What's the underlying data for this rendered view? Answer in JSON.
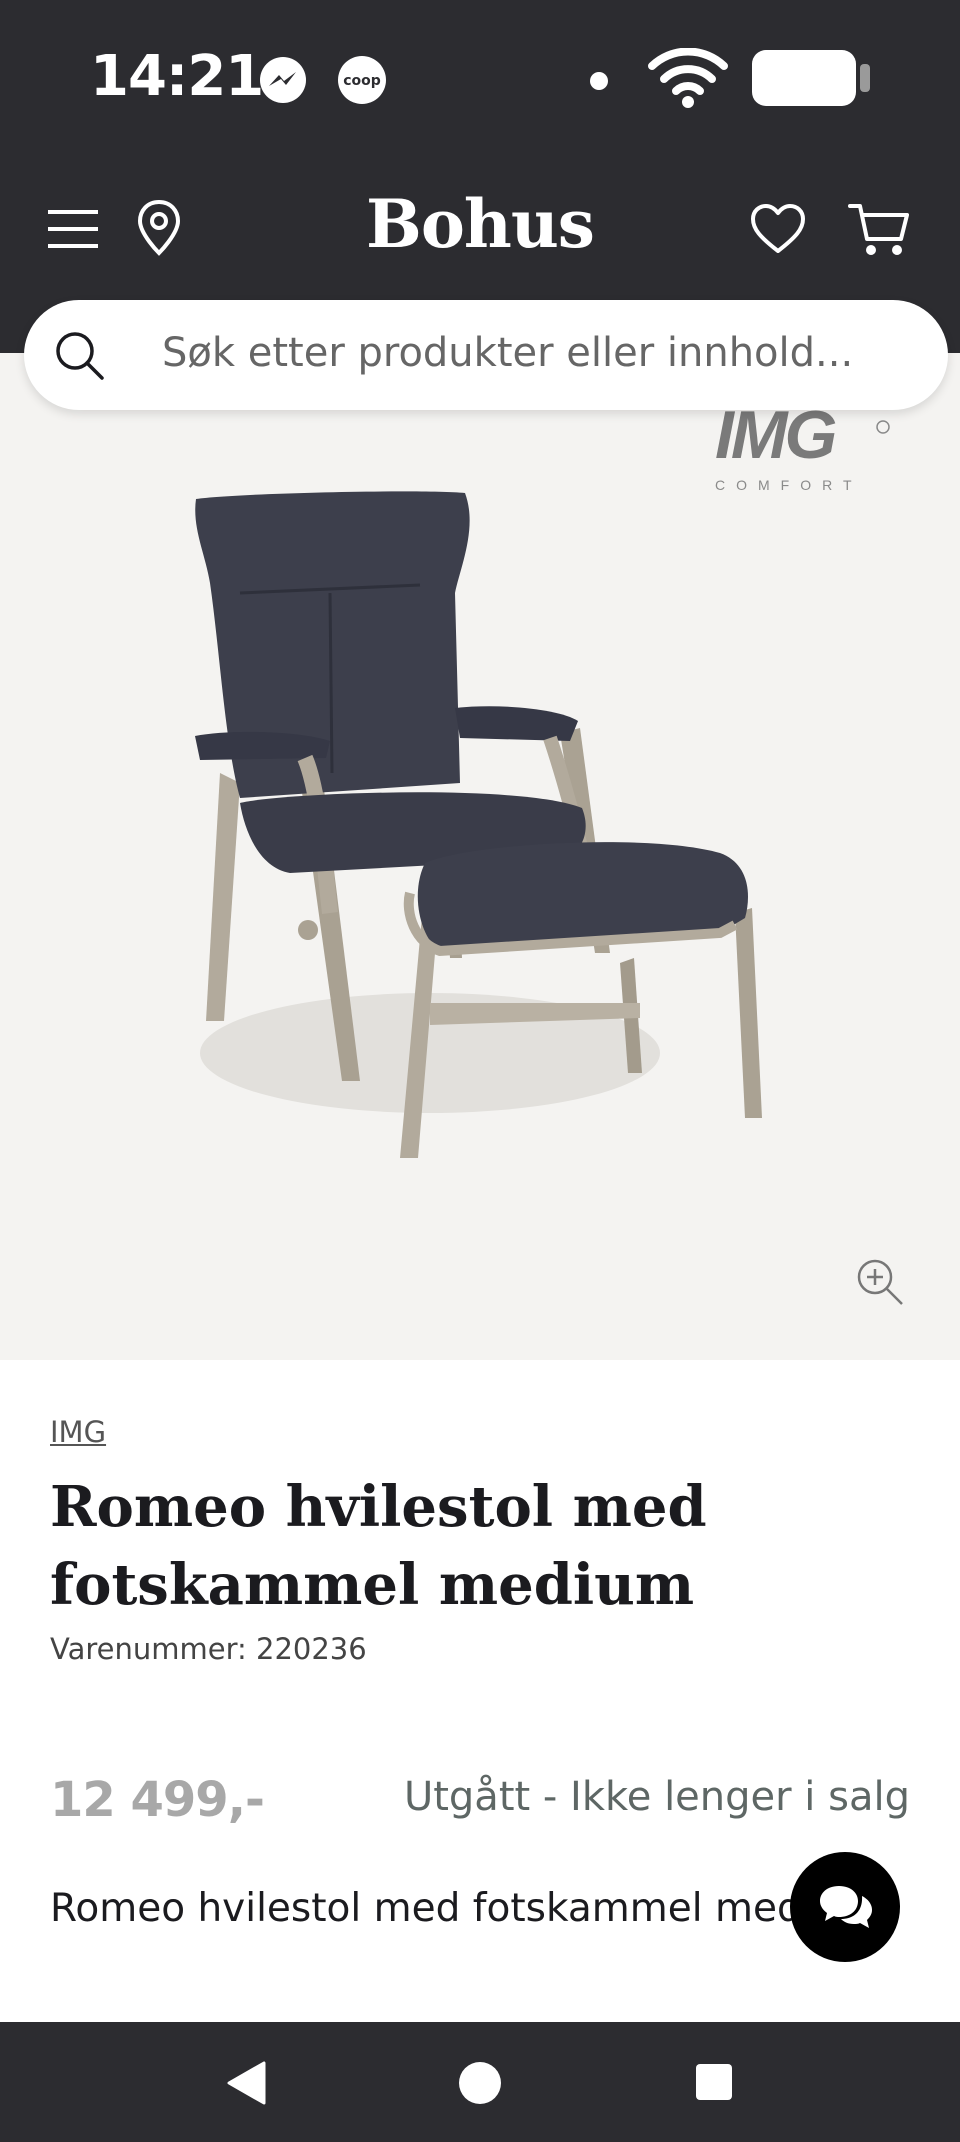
{
  "status_bar": {
    "time": "14:21",
    "icons": [
      "messenger-icon",
      "coop-icon",
      "notification-dot-icon",
      "wifi-icon",
      "battery-icon"
    ],
    "coop_label": "coop"
  },
  "header": {
    "logo": "Bohus",
    "icons": [
      "menu-icon",
      "location-icon",
      "heart-icon",
      "cart-icon"
    ]
  },
  "search": {
    "placeholder": "Søk etter produkter eller innhold..."
  },
  "product": {
    "brand_logo": "IMG",
    "brand_logo_sub": "COMFORT",
    "brand_link": "IMG",
    "title": "Romeo hvilestol med fotskammel medium",
    "sku": "Varenummer: 220236",
    "price": "12 499,-",
    "stock_status": "Utgått - Ikke lenger i salg",
    "description": "Romeo hvilestol med fotskammel medium"
  },
  "colors": {
    "header_bg": "#2c2c30",
    "image_bg": "#f4f3f1",
    "price_gray": "#a8a8a8",
    "chair_fabric": "#3d3f4c",
    "chair_wood": "#b2aa9c"
  }
}
